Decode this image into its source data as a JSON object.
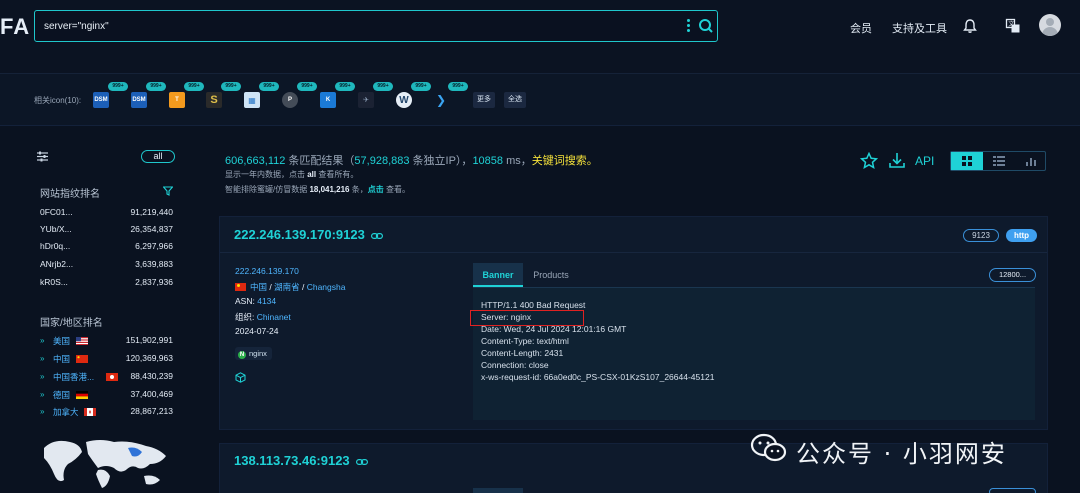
{
  "header": {
    "logo": "FA",
    "search_value": "server=\"nginx\"",
    "nav": [
      "会员",
      "支持及工具"
    ]
  },
  "icon_strip": {
    "label": "相关icon(10):",
    "badge": "999+",
    "icons": [
      "DSM",
      "DSM",
      "",
      "",
      "",
      "P",
      "K",
      "",
      "",
      ""
    ],
    "more": "更多",
    "all": "全选"
  },
  "sidebar": {
    "all_label": "all",
    "fingerprint_title": "网站指纹排名",
    "fingerprints": [
      {
        "name": "0FC01...",
        "count": "91,219,440"
      },
      {
        "name": "YUb/X...",
        "count": "26,354,837"
      },
      {
        "name": "hDr0q...",
        "count": "6,297,966"
      },
      {
        "name": "ANrjb2...",
        "count": "3,639,883"
      },
      {
        "name": "kR0S...",
        "count": "2,837,936"
      }
    ],
    "country_title": "国家/地区排名",
    "countries": [
      {
        "name": "美国",
        "count": "151,902,991",
        "flag": "us"
      },
      {
        "name": "中国",
        "count": "120,369,963",
        "flag": "cn"
      },
      {
        "name": "中国香港...",
        "count": "88,430,239",
        "flag": "hk"
      },
      {
        "name": "德国",
        "count": "37,400,469",
        "flag": "de"
      },
      {
        "name": "加拿大",
        "count": "28,867,213",
        "flag": "ca"
      }
    ]
  },
  "summary": {
    "total": "606,663,112",
    "t1": " 条匹配结果（",
    "unique": "57,928,883",
    "t2": " 条独立IP），",
    "ms": "10858",
    "t3": " ms，",
    "keyword": "关键词搜索。",
    "line2_a": "显示一年内数据，点击 ",
    "line2_b": "all",
    "line2_c": " 查看所有。",
    "line3_a": "智能排除蜜罐/仿冒数据 ",
    "line3_b": "18,041,216",
    "line3_c": " 条，",
    "line3_d": "点击",
    "line3_e": " 查看。",
    "api": "API"
  },
  "result1": {
    "title": "222.246.139.170:9123",
    "port": "9123",
    "protocol": "http",
    "ip": "222.246.139.170",
    "country": "中国",
    "province": "湖南省",
    "city": "Changsha",
    "asn_label": "ASN:",
    "asn": "4134",
    "org_label": "组织:",
    "org": "Chinanet",
    "date": "2024-07-24",
    "tag": "nginx",
    "tab_banner": "Banner",
    "tab_products": "Products",
    "size": "12800...",
    "banner_lines": [
      "HTTP/1.1 400 Bad Request",
      "Server: nginx",
      "Date: Wed, 24 Jul 2024 12:01:16 GMT",
      "Content-Type: text/html",
      "Content-Length: 2431",
      "Connection: close",
      "x-ws-request-id: 66a0ed0c_PS-CSX-01KzS107_26644-45121"
    ]
  },
  "result2": {
    "title": "138.113.73.46:9123"
  },
  "watermark": {
    "text": "公众号 · 小羽网安"
  }
}
